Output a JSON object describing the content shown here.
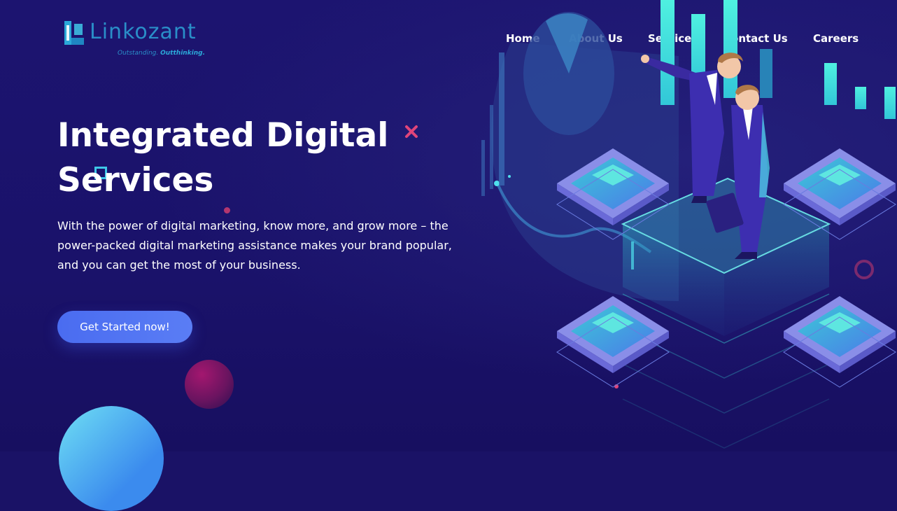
{
  "brand": {
    "name": "Linkozant",
    "tagline_prefix": "Outstanding.",
    "tagline_bold": "Outthinking."
  },
  "nav": {
    "items": [
      "Home",
      "About Us",
      "Services",
      "Contact Us",
      "Careers"
    ]
  },
  "hero": {
    "title_line1": "Integrated Digital",
    "title_line2": "Services",
    "description": "With the power of digital marketing, know more, and grow more – the power-packed digital marketing assistance makes your brand popular, and you can get the most of your business.",
    "cta_label": "Get Started now!"
  },
  "colors": {
    "background": "#1a1266",
    "accent": "#4a6cf0",
    "teal": "#3de0dc",
    "logo": "#2a8ec8",
    "pink": "#e0457a"
  },
  "icons": {
    "decor_x": "close-icon",
    "decor_square": "square-outline-icon",
    "decor_ring": "ring-icon"
  }
}
